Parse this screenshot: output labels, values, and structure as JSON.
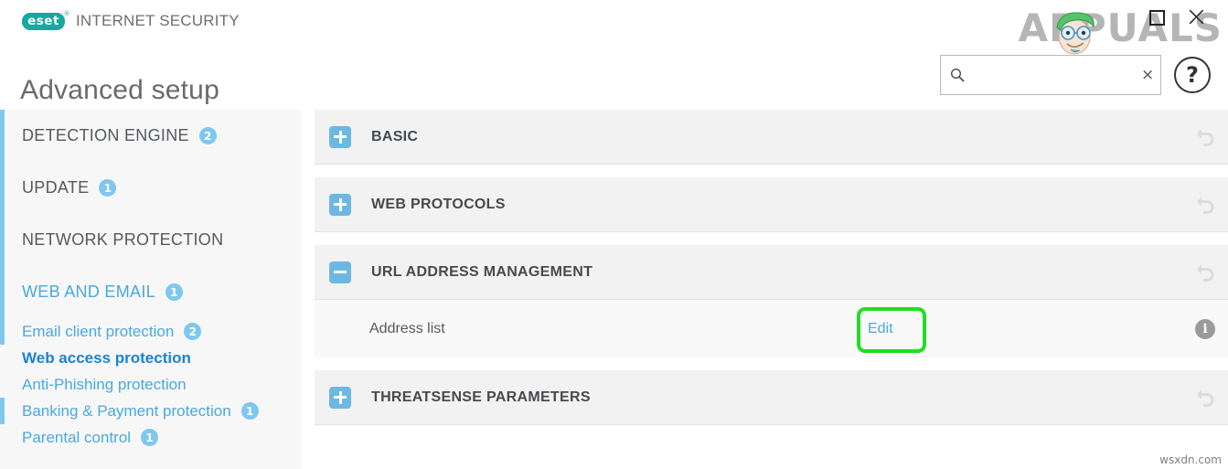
{
  "window": {
    "maximize_label": "□",
    "close_label": "×"
  },
  "brand": {
    "logo_text": "eset",
    "suite_name": "INTERNET SECURITY"
  },
  "header": {
    "page_title": "Advanced setup"
  },
  "search": {
    "value": "",
    "placeholder": "",
    "clear_label": "×",
    "icon": "search-icon"
  },
  "help": {
    "label": "?"
  },
  "sidebar": {
    "items": [
      {
        "label": "DETECTION ENGINE",
        "badge": "2",
        "level": "top",
        "accent": true,
        "active": false,
        "blue": false
      },
      {
        "label": "UPDATE",
        "badge": "1",
        "level": "top",
        "accent": true,
        "active": false,
        "blue": false
      },
      {
        "label": "NETWORK PROTECTION",
        "badge": "",
        "level": "top",
        "accent": true,
        "active": false,
        "blue": false
      },
      {
        "label": "WEB AND EMAIL",
        "badge": "1",
        "level": "top",
        "accent": true,
        "active": false,
        "blue": true
      },
      {
        "label": "Email client protection",
        "badge": "2",
        "level": "sub",
        "accent": true,
        "active": false,
        "blue": false
      },
      {
        "label": "Web access protection",
        "badge": "",
        "level": "sub",
        "accent": false,
        "active": true,
        "blue": false
      },
      {
        "label": "Anti-Phishing protection",
        "badge": "",
        "level": "sub",
        "accent": false,
        "active": false,
        "blue": false
      },
      {
        "label": "Banking & Payment protection",
        "badge": "1",
        "level": "sub",
        "accent": true,
        "active": false,
        "blue": false
      },
      {
        "label": "Parental control",
        "badge": "1",
        "level": "sub",
        "accent": false,
        "active": false,
        "blue": false
      }
    ]
  },
  "main": {
    "sections": [
      {
        "title": "BASIC",
        "expanded": false
      },
      {
        "title": "WEB PROTOCOLS",
        "expanded": false
      },
      {
        "title": "URL ADDRESS MANAGEMENT",
        "expanded": true
      },
      {
        "title": "THREATSENSE PARAMETERS",
        "expanded": false
      }
    ],
    "address_row": {
      "label": "Address list",
      "edit_label": "Edit",
      "info_label": "i"
    }
  },
  "watermarks": {
    "top_right": "APPUALS",
    "bottom_right": "wsxdn.com"
  },
  "colors": {
    "brand_teal": "#17a8a0",
    "accent_blue": "#7ec8ef",
    "link_blue": "#4aa8e0",
    "active_blue": "#1a82d4",
    "highlight_green": "#22dd22",
    "section_bg": "#f2f2f2",
    "sidebar_bg": "#f7f7f7"
  }
}
